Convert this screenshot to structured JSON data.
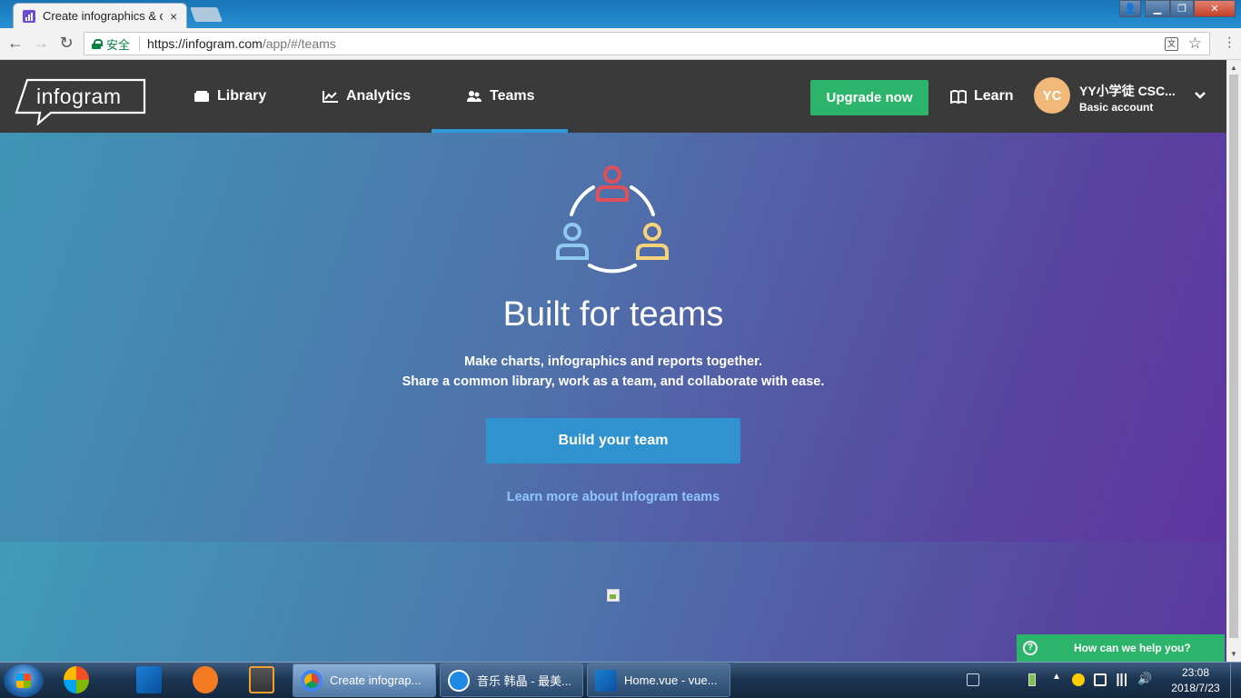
{
  "browser": {
    "tab_title": "Create infographics & c",
    "tab_close": "×",
    "secure_label": "安全",
    "url_host": "https://infogram.com",
    "url_path": "/app/#/teams",
    "back_icon": "←",
    "forward_icon": "→",
    "reload_icon": "↻",
    "star_icon": "☆",
    "translate_icon": "文"
  },
  "header": {
    "logo_text": "infogram",
    "nav": [
      {
        "label": "Library"
      },
      {
        "label": "Analytics"
      },
      {
        "label": "Teams"
      }
    ],
    "upgrade_label": "Upgrade now",
    "learn_label": "Learn",
    "avatar_initials": "YC",
    "account_name": "YY小学徒 CSC...",
    "account_plan": "Basic account"
  },
  "hero": {
    "title": "Built for teams",
    "subtitle_line1": "Make charts, infographics and reports together.",
    "subtitle_line2": "Share a common library, work as a team, and collaborate with ease.",
    "cta_label": "Build your team",
    "learn_more": "Learn more about Infogram teams",
    "icon_colors": [
      "#e0505a",
      "#8fc8f0",
      "#f5d37a"
    ]
  },
  "help": {
    "icon": "?",
    "label": "How can we help you?"
  },
  "taskbar": {
    "tasks": [
      {
        "label": "Create infograp..."
      },
      {
        "label": "音乐 韩晶 - 最美..."
      },
      {
        "label": "Home.vue - vue..."
      }
    ],
    "time": "23:08",
    "date": "2018/7/23"
  },
  "colors": {
    "header_bg": "#3a3a3a",
    "accent_green": "#2cb56a",
    "accent_blue": "#3192d0",
    "tab_underline": "#2e9ad8"
  }
}
